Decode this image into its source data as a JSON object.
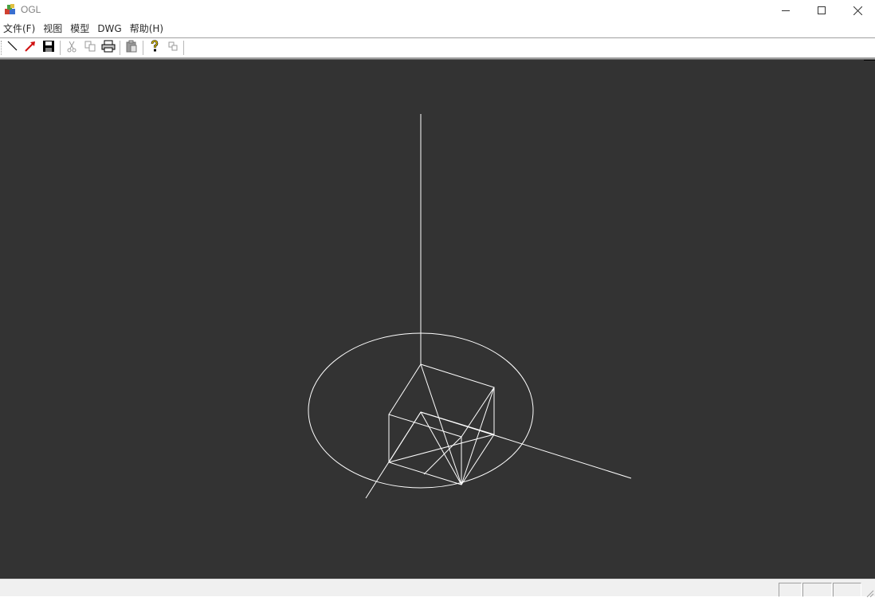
{
  "window": {
    "title": "OGL",
    "icon": "ogl-app-icon",
    "controls": [
      "minimize-icon",
      "maximize-icon",
      "close-icon"
    ]
  },
  "menu": [
    {
      "label": "文件(F)"
    },
    {
      "label": "视图"
    },
    {
      "label": "模型"
    },
    {
      "label": "DWG"
    },
    {
      "label": "帮助(H)"
    }
  ],
  "toolbar": {
    "buttons": [
      {
        "icon": "line-tool-icon"
      },
      {
        "icon": "red-arrow-icon"
      },
      {
        "icon": "save-icon"
      },
      {
        "icon": "cut-icon"
      },
      {
        "icon": "copy-icon"
      },
      {
        "icon": "print-icon"
      },
      {
        "icon": "paste-icon"
      },
      {
        "icon": "help-icon"
      },
      {
        "icon": "context-help-icon"
      }
    ]
  },
  "viewport": {
    "background": "#333333",
    "line_color": "#ffffff",
    "scene": "wireframe cube with coordinate axes and circle"
  },
  "statusbar": {
    "panes": [
      "",
      "",
      ""
    ]
  }
}
